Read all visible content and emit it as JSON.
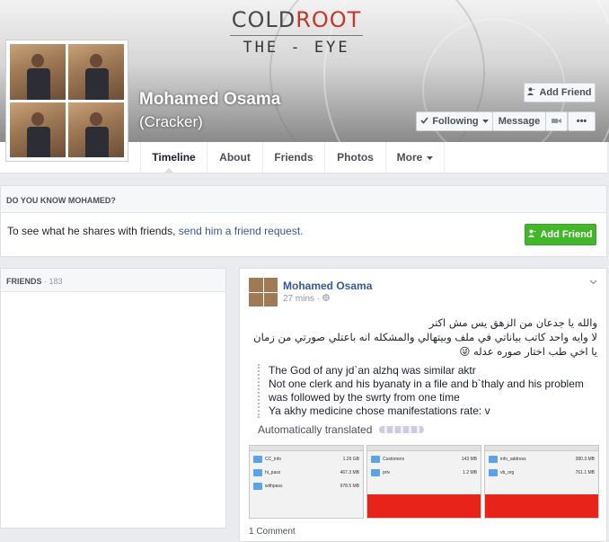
{
  "cover": {
    "brand_cold": "COLD",
    "brand_root": "ROOT",
    "brand_sub": "THE - EYE"
  },
  "profile": {
    "name": "Mohamed Osama",
    "alias": "(Cracker)"
  },
  "actions": {
    "add_friend": "Add Friend",
    "following": "Following",
    "message": "Message",
    "more": "•••"
  },
  "tabs": [
    {
      "label": "Timeline"
    },
    {
      "label": "About"
    },
    {
      "label": "Friends"
    },
    {
      "label": "Photos"
    },
    {
      "label": "More"
    }
  ],
  "know": {
    "header": "DO YOU KNOW MOHAMED?",
    "text": "To see what he shares with friends, ",
    "link": "send him a friend request.",
    "button": "Add Friend"
  },
  "friends": {
    "header": "FRIENDS",
    "sep": " · ",
    "count": "183"
  },
  "post": {
    "author": "Mohamed Osama",
    "time": "27 mins · ",
    "arabic": [
      "والله يا جدعان من الزهق يس مش اكتر",
      "لا وايه واحد كاتب بياناتي في ملف وبيتهالي والمشكله انه باعتلي صورتي من زمان",
      "يا اخي طب اختار صوره عدله 😜"
    ],
    "translation": [
      "The God of any jd`an alzhq was similar aktr",
      "Not one clerk and his byanaty in a file and b`thaly and his problem was followed by the swrty from one time",
      "Ya akhy medicine chose manifestations rate: v"
    ],
    "auto_translated": "Automatically translated",
    "comments": "1 Comment"
  },
  "screenshots": [
    {
      "title": "CC_info",
      "rows": [
        {
          "name": "CC_info",
          "size": "1.26 GB"
        },
        {
          "name": "hi_pass",
          "size": "467.3 MB"
        },
        {
          "name": "withpass",
          "size": "978.5 MB"
        }
      ]
    },
    {
      "title": "Customers",
      "rows": [
        {
          "name": "Customers",
          "size": "143 MB"
        },
        {
          "name": "priv",
          "size": "1.2 MB"
        }
      ]
    },
    {
      "title": "info_address",
      "rows": [
        {
          "name": "info_address",
          "size": "380.3 MB"
        },
        {
          "name": "vb_org",
          "size": "761.1 MB"
        }
      ]
    }
  ]
}
